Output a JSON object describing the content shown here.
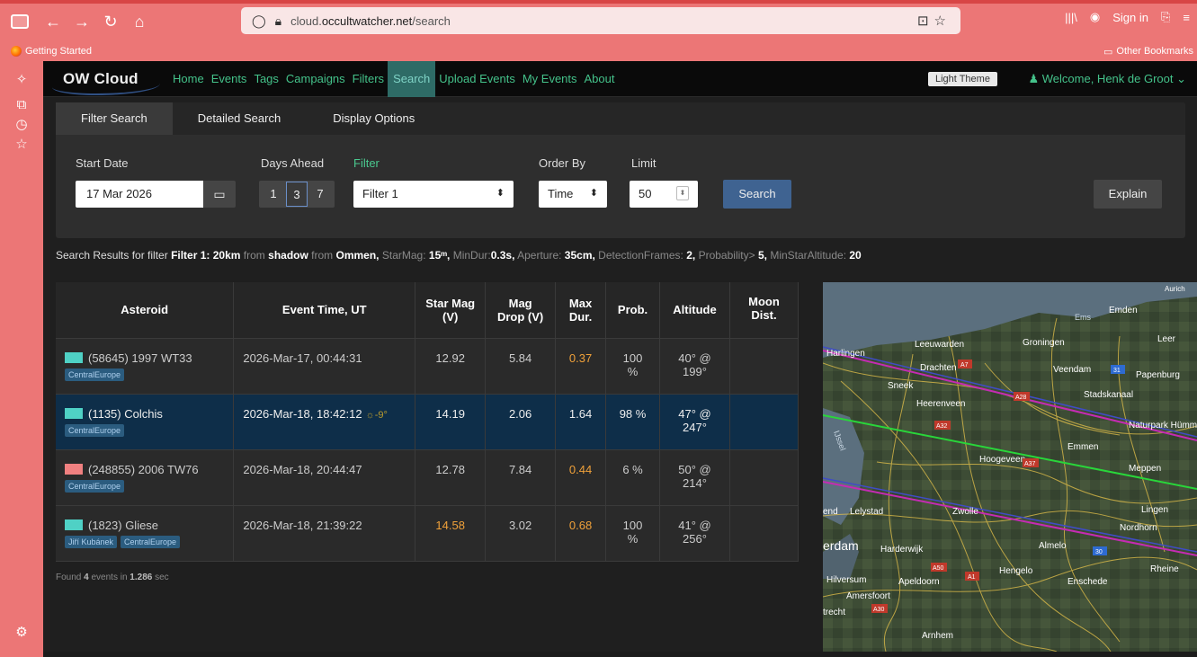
{
  "browser": {
    "url_prefix": "cloud.",
    "url_host": "occultwatcher.net",
    "url_path": "/search",
    "bookmark_getting_started": "Getting Started",
    "bookmark_other": "Other Bookmarks",
    "sign_in": "Sign in"
  },
  "nav": {
    "brand": "OW Cloud",
    "links": [
      "Home",
      "Events",
      "Tags",
      "Campaigns",
      "Filters",
      "Search",
      "Upload Events",
      "My Events",
      "About"
    ],
    "light_theme": "Light Theme",
    "welcome": "Welcome, Henk de Groot"
  },
  "tabs": [
    "Filter Search",
    "Detailed Search",
    "Display Options"
  ],
  "form": {
    "start_date_label": "Start Date",
    "start_date_value": "17 Mar 2026",
    "days_ahead_label": "Days Ahead",
    "days": [
      "1",
      "3",
      "7"
    ],
    "filter_label": "Filter",
    "filter_value": "Filter 1",
    "order_by_label": "Order By",
    "order_by_value": "Time",
    "limit_label": "Limit",
    "limit_value": "50",
    "search_button": "Search",
    "explain_button": "Explain"
  },
  "summary": {
    "prefix": "Search Results for filter",
    "filter": "Filter 1:",
    "dist": "20km",
    "from": "from",
    "shadow": "shadow",
    "from2": "from",
    "place": "Ommen,",
    "starmag_label": "StarMag:",
    "starmag": "15ᵐ,",
    "mindur_label": "MinDur:",
    "mindur": "0.3s,",
    "aperture_label": "Aperture:",
    "aperture": "35cm,",
    "frames_label": "DetectionFrames:",
    "frames": "2,",
    "prob_label": "Probability>",
    "prob": "5,",
    "alt_label": "MinStarAltitude:",
    "alt": "20"
  },
  "table": {
    "headers": {
      "asteroid": "Asteroid",
      "time": "Event Time, UT",
      "star_mag_1": "Star Mag",
      "star_mag_2": "(V)",
      "mag_drop_1": "Mag",
      "mag_drop_2": "Drop (V)",
      "max_dur_1": "Max",
      "max_dur_2": "Dur.",
      "prob": "Prob.",
      "altitude": "Altitude",
      "moon_1": "Moon",
      "moon_2": "Dist."
    },
    "rows": [
      {
        "name": "(58645) 1997 WT33",
        "color": "#4fd1c5",
        "tags": [
          "CentralEurope"
        ],
        "time": "2026-Mar-17, 00:44:31",
        "sun": "",
        "star_mag": "12.92",
        "mag_drop": "5.84",
        "max_dur": "0.37",
        "prob_1": "100",
        "prob_2": "%",
        "alt_1": "40° @",
        "alt_2": "199°"
      },
      {
        "name": "(1135) Colchis",
        "color": "#4fd1c5",
        "tags": [
          "CentralEurope"
        ],
        "time": "2026-Mar-18, 18:42:12",
        "sun": "☼-9°",
        "star_mag": "14.19",
        "mag_drop": "2.06",
        "max_dur": "1.64",
        "prob_1": "98 %",
        "prob_2": "",
        "alt_1": "47° @",
        "alt_2": "247°"
      },
      {
        "name": "(248855) 2006 TW76",
        "color": "#f08080",
        "tags": [
          "CentralEurope"
        ],
        "time": "2026-Mar-18, 20:44:47",
        "sun": "",
        "star_mag": "12.78",
        "mag_drop": "7.84",
        "max_dur": "0.44",
        "prob_1": "6 %",
        "prob_2": "",
        "alt_1": "50° @",
        "alt_2": "214°"
      },
      {
        "name": "(1823) Gliese",
        "color": "#4fd1c5",
        "tags": [
          "Jiří Kubánek",
          "CentralEurope"
        ],
        "time": "2026-Mar-18, 21:39:22",
        "sun": "",
        "star_mag": "14.58",
        "mag_drop": "3.02",
        "max_dur": "0.68",
        "prob_1": "100",
        "prob_2": "%",
        "alt_1": "41° @",
        "alt_2": "256°"
      }
    ]
  },
  "found": {
    "prefix": "Found",
    "count": "4",
    "mid": "events in",
    "time": "1.286",
    "suffix": "sec"
  },
  "map_labels": [
    "Emden",
    "Leer",
    "Groningen",
    "Leeuwarden",
    "Harlingen",
    "Drachten",
    "Veendam",
    "Papenburg",
    "Sneek",
    "Stadskanaal",
    "Heerenveen",
    "Naturpark Hümmling",
    "Emmen",
    "Hoogeveen",
    "Meppen",
    "Lelystad",
    "Zwolle",
    "Lingen",
    "Nordhorn",
    "Harderwijk",
    "Almelo",
    "Hilversum",
    "Apeldoorn",
    "Amersfoort",
    "Hengelo",
    "Enschede",
    "Rheine",
    "Arnhem",
    "Ems",
    "IJssel",
    "erdam",
    "trecht",
    "end",
    "Aurich",
    "A7",
    "A28",
    "A32",
    "A37",
    "A50",
    "A1",
    "A30",
    "31",
    "30"
  ]
}
